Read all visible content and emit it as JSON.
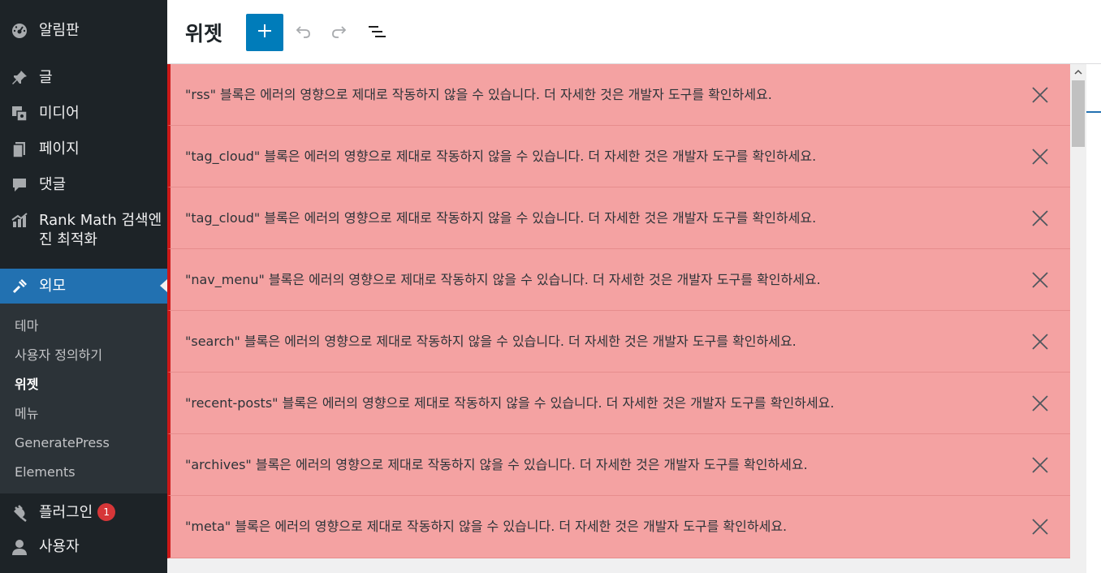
{
  "sidebar": {
    "items": [
      {
        "label": "알림판",
        "icon": "dashboard-icon"
      },
      {
        "label": "글",
        "icon": "pin-icon"
      },
      {
        "label": "미디어",
        "icon": "media-icon"
      },
      {
        "label": "페이지",
        "icon": "pages-icon"
      },
      {
        "label": "댓글",
        "icon": "comments-icon"
      },
      {
        "label": "Rank Math 검색엔진 최적화",
        "icon": "rank-math-icon"
      },
      {
        "label": "외모",
        "icon": "brush-icon"
      },
      {
        "label": "플러그인",
        "icon": "plugin-icon",
        "badge": "1"
      },
      {
        "label": "사용자",
        "icon": "user-icon"
      }
    ],
    "submenu": [
      "테마",
      "사용자 정의하기",
      "위젯",
      "메뉴",
      "GeneratePress",
      "Elements"
    ],
    "current_submenu": "위젯"
  },
  "header": {
    "title": "위젯",
    "add_icon": "plus-icon",
    "undo_icon": "undo-icon",
    "redo_icon": "redo-icon",
    "list_view_icon": "list-view-icon"
  },
  "notices": [
    "\"rss\" 블록은 에러의 영향으로 제대로 작동하지 않을 수 있습니다. 더 자세한 것은 개발자 도구를 확인하세요.",
    "\"tag_cloud\" 블록은 에러의 영향으로 제대로 작동하지 않을 수 있습니다. 더 자세한 것은 개발자 도구를 확인하세요.",
    "\"tag_cloud\" 블록은 에러의 영향으로 제대로 작동하지 않을 수 있습니다. 더 자세한 것은 개발자 도구를 확인하세요.",
    "\"nav_menu\" 블록은 에러의 영향으로 제대로 작동하지 않을 수 있습니다. 더 자세한 것은 개발자 도구를 확인하세요.",
    "\"search\" 블록은 에러의 영향으로 제대로 작동하지 않을 수 있습니다. 더 자세한 것은 개발자 도구를 확인하세요.",
    "\"recent-posts\" 블록은 에러의 영향으로 제대로 작동하지 않을 수 있습니다. 더 자세한 것은 개발자 도구를 확인하세요.",
    "\"archives\" 블록은 에러의 영향으로 제대로 작동하지 않을 수 있습니다. 더 자세한 것은 개발자 도구를 확인하세요.",
    "\"meta\" 블록은 에러의 영향으로 제대로 작동하지 않을 수 있습니다. 더 자세한 것은 개발자 도구를 확인하세요."
  ],
  "colors": {
    "sidebar_bg": "#1d2327",
    "submenu_bg": "#2c3338",
    "active_bg": "#2271b1",
    "primary_button": "#007cba",
    "notice_bg": "#f4a2a2",
    "notice_border": "#cc1818",
    "badge": "#d63638"
  }
}
